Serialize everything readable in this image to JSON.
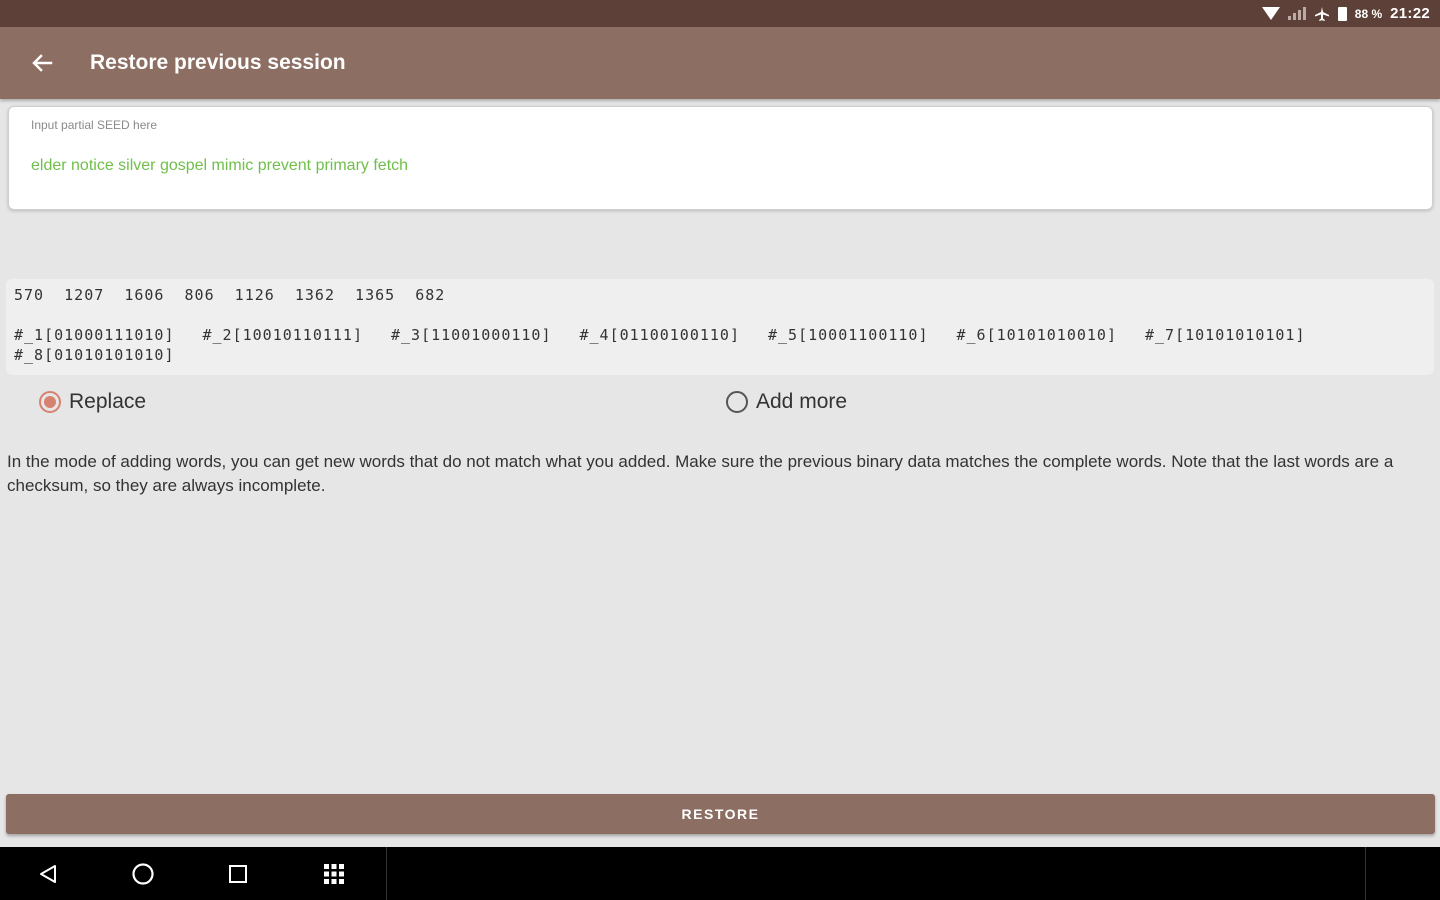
{
  "status_bar": {
    "battery_pct": "88 %",
    "time": "21:22",
    "icons": [
      "wifi-icon",
      "signal-icon",
      "airplane-icon",
      "battery-icon"
    ]
  },
  "app_bar": {
    "title": "Restore previous session",
    "back_icon": "arrow-left-icon"
  },
  "seed_input": {
    "placeholder": "Input partial SEED here",
    "value": "elder notice silver gospel mimic prevent primary fetch"
  },
  "binary": {
    "numbers": "570  1207  1606  806  1126  1362  1365  682",
    "words": [
      "#_1[01000111010]",
      "#_2[10010110111]",
      "#_3[11001000110]",
      "#_4[01100100110]",
      "#_5[10001100110]",
      "#_6[10101010010]",
      "#_7[10101010101]",
      "#_8[01010101010]"
    ]
  },
  "mode": {
    "options": [
      {
        "label": "Replace",
        "checked": true
      },
      {
        "label": "Add more",
        "checked": false
      }
    ]
  },
  "note": "In the mode of adding words, you can get new words that do not match what you added. Make sure the previous binary data matches the complete words. Note that the last words are a checksum, so they are always incomplete.",
  "restore_label": "RESTORE",
  "colors": {
    "status_bar": "#5d4037",
    "app_bar": "#8d6e63",
    "seed_text": "#6fbf4a",
    "radio_accent": "#d7826f",
    "background": "#e6e6e6"
  },
  "nav_bar": {
    "icons": [
      "back-triangle-icon",
      "home-circle-icon",
      "recents-square-icon",
      "apps-grid-icon"
    ]
  }
}
